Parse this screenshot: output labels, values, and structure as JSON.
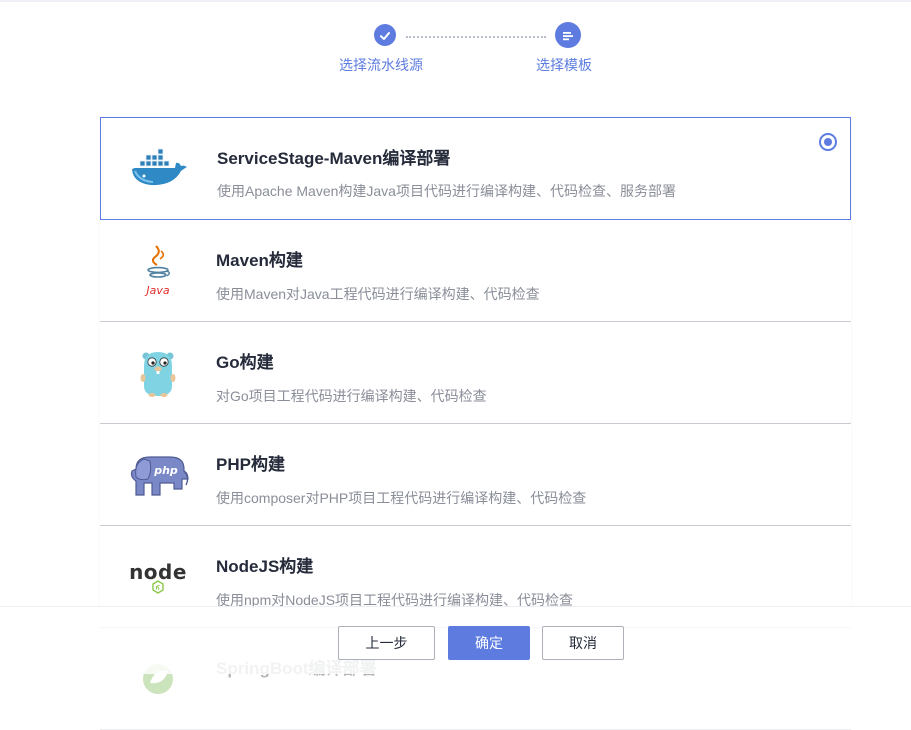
{
  "stepper": {
    "steps": [
      {
        "label": "选择流水线源",
        "state": "done",
        "icon": "check-icon"
      },
      {
        "label": "选择模板",
        "state": "active",
        "icon": "list-icon"
      }
    ]
  },
  "templates": [
    {
      "title": "ServiceStage-Maven编译部署",
      "description": "使用Apache Maven构建Java项目代码进行编译构建、代码检查、服务部署",
      "logo": "docker-whale-logo",
      "selected": true
    },
    {
      "title": "Maven构建",
      "description": "使用Maven对Java工程代码进行编译构建、代码检查",
      "logo": "java-logo",
      "logo_text": "Java",
      "selected": false
    },
    {
      "title": "Go构建",
      "description": "对Go项目工程代码进行编译构建、代码检查",
      "logo": "go-gopher-logo",
      "selected": false
    },
    {
      "title": "PHP构建",
      "description": "使用composer对PHP项目工程代码进行编译构建、代码检查",
      "logo": "php-elephant-logo",
      "logo_text": "php",
      "selected": false
    },
    {
      "title": "NodeJS构建",
      "description": "使用npm对NodeJS项目工程代码进行编译构建、代码检查",
      "logo": "nodejs-logo",
      "logo_text": "node",
      "selected": false
    },
    {
      "title": "SpringBoot编译部署",
      "description": "",
      "logo": "springboot-logo",
      "selected": false
    }
  ],
  "footer": {
    "prev_label": "上一步",
    "confirm_label": "确定",
    "cancel_label": "取消"
  },
  "colors": {
    "accent": "#5e7ce0",
    "title_text": "#252b3a",
    "desc_text": "#8a8e99",
    "border": "#c9ccd3"
  }
}
